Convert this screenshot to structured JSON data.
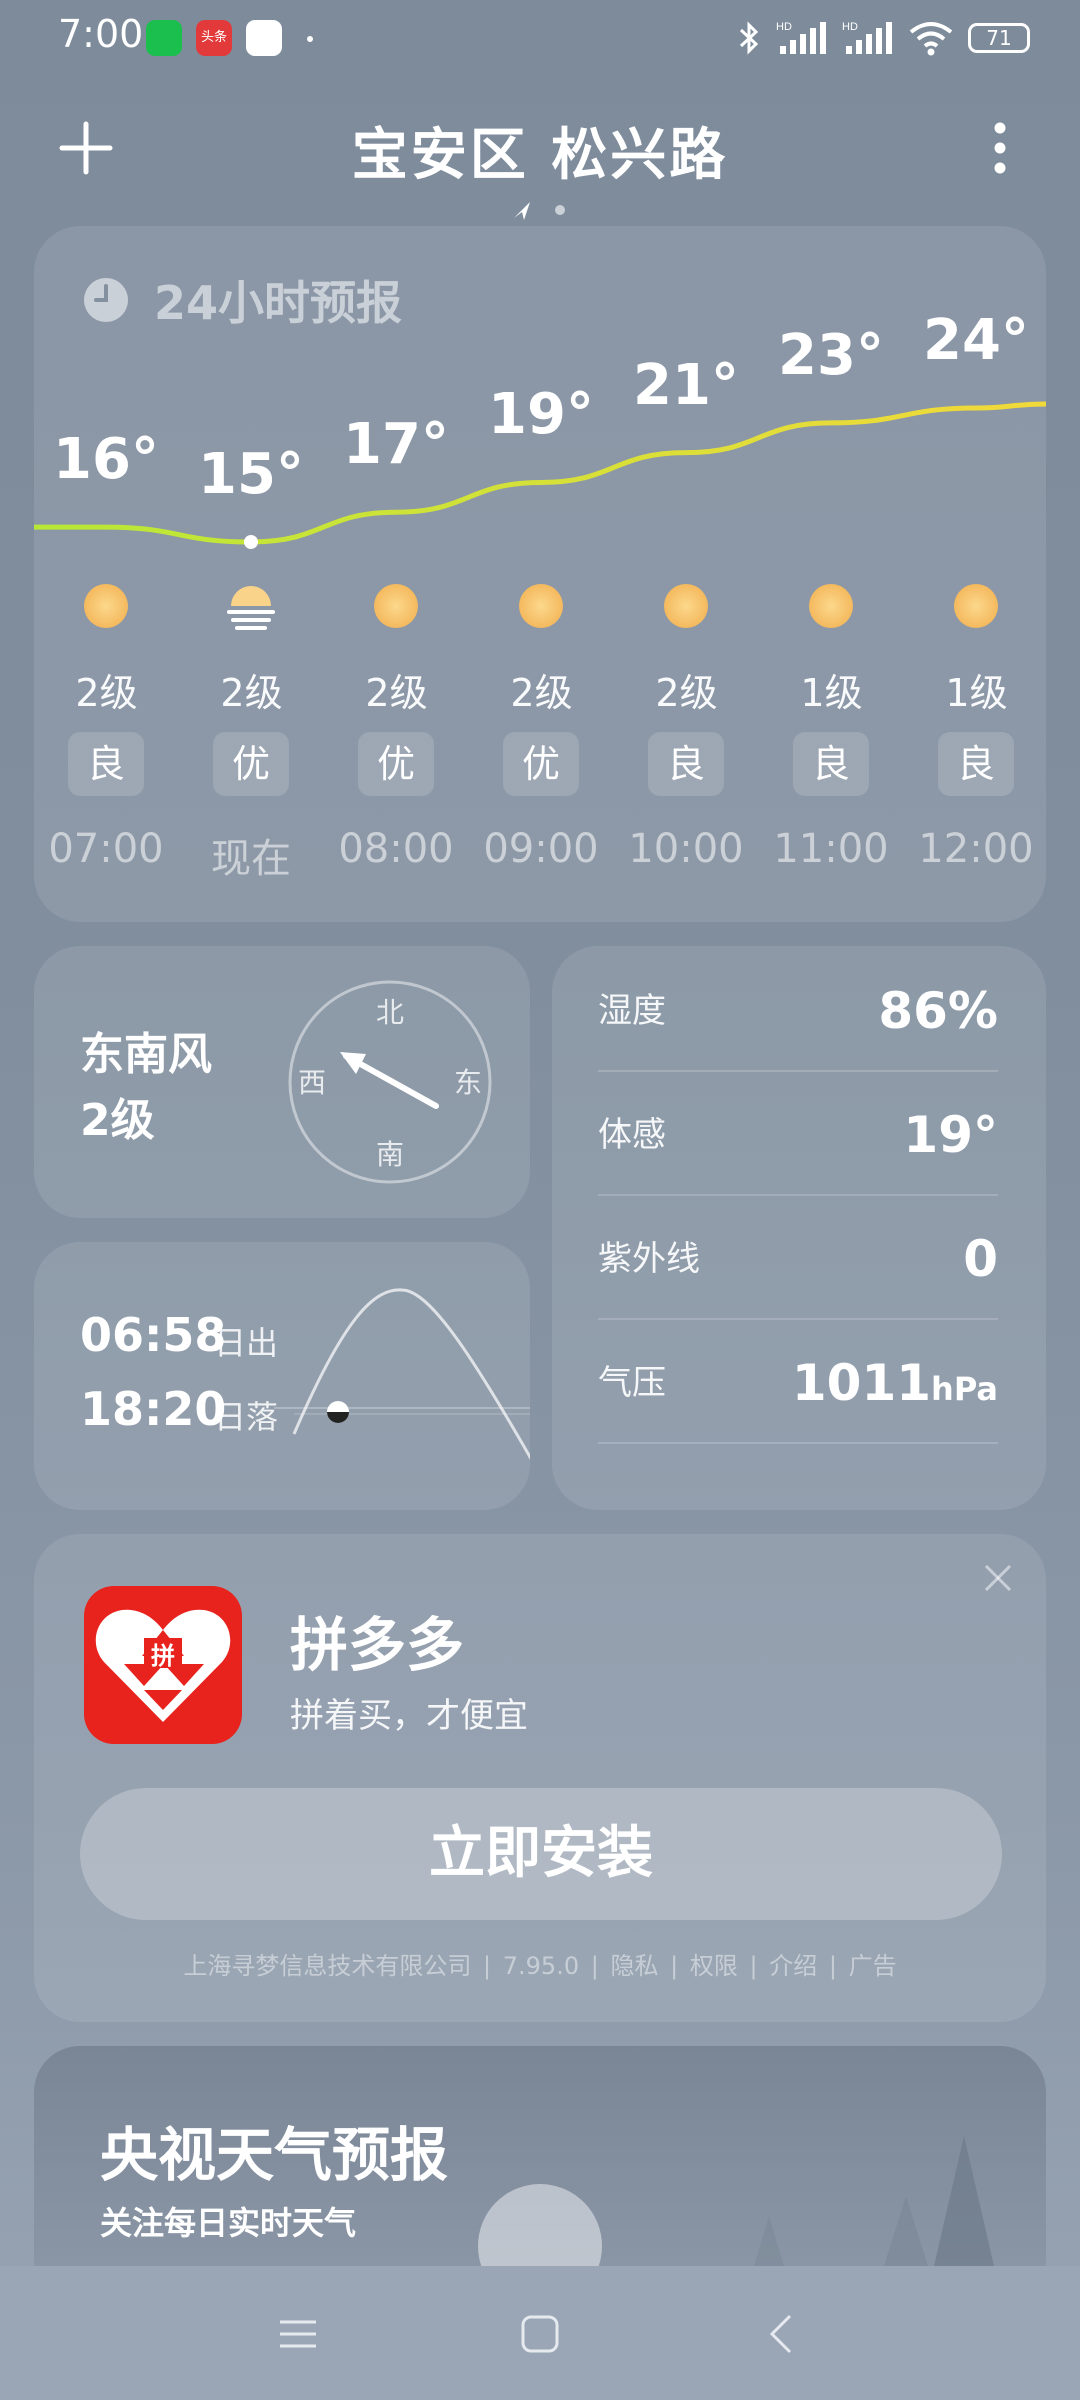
{
  "status_bar": {
    "time": "7:00",
    "app_badges": [
      "wechat-icon",
      "toutiao-icon",
      "app-icon"
    ],
    "toutiao_text": "头条",
    "battery": "71"
  },
  "header": {
    "location": "宝安区 松兴路"
  },
  "forecast": {
    "title": "24小时预报",
    "hours": [
      {
        "time": "07:00",
        "temp": "16°",
        "temp_value": 16,
        "icon": "sun-icon",
        "wind": "2级",
        "aqi": "良"
      },
      {
        "time": "现在",
        "temp": "15°",
        "temp_value": 15,
        "icon": "sunset-haze-icon",
        "wind": "2级",
        "aqi": "优"
      },
      {
        "time": "08:00",
        "temp": "17°",
        "temp_value": 17,
        "icon": "sun-icon",
        "wind": "2级",
        "aqi": "优"
      },
      {
        "time": "09:00",
        "temp": "19°",
        "temp_value": 19,
        "icon": "sun-icon",
        "wind": "2级",
        "aqi": "优"
      },
      {
        "time": "10:00",
        "temp": "21°",
        "temp_value": 21,
        "icon": "sun-icon",
        "wind": "2级",
        "aqi": "良"
      },
      {
        "time": "11:00",
        "temp": "23°",
        "temp_value": 23,
        "icon": "sun-icon",
        "wind": "1级",
        "aqi": "良"
      },
      {
        "time": "12:00",
        "temp": "24°",
        "temp_value": 24,
        "icon": "sun-icon",
        "wind": "1级",
        "aqi": "良"
      }
    ],
    "line_colors": {
      "start": "#b8e836",
      "end": "#f2d93a"
    }
  },
  "wind": {
    "direction": "东南风",
    "level": "2级",
    "compass": {
      "north": "北",
      "south": "南",
      "east": "东",
      "west": "西"
    }
  },
  "sun": {
    "sunrise_time": "06:58",
    "sunrise_label": "日出",
    "sunset_time": "18:20",
    "sunset_label": "日落"
  },
  "details": [
    {
      "label": "湿度",
      "value": "86%",
      "unit": ""
    },
    {
      "label": "体感",
      "value": "19°",
      "unit": ""
    },
    {
      "label": "紫外线",
      "value": "0",
      "unit": ""
    },
    {
      "label": "气压",
      "value": "1011",
      "unit": "hPa"
    }
  ],
  "ad": {
    "app_name": "拼多多",
    "slogan": "拼着买，才便宜",
    "install_label": "立即安装",
    "meta": [
      "上海寻梦信息技术有限公司",
      "|",
      "7.95.0",
      "|",
      "隐私",
      "|",
      "权限",
      "|",
      "介绍",
      "|",
      "广告"
    ],
    "icon_text": "拼",
    "brand_color": "#e8221c"
  },
  "promo": {
    "title": "央视天气预报",
    "subtitle": "关注每日实时天气"
  }
}
